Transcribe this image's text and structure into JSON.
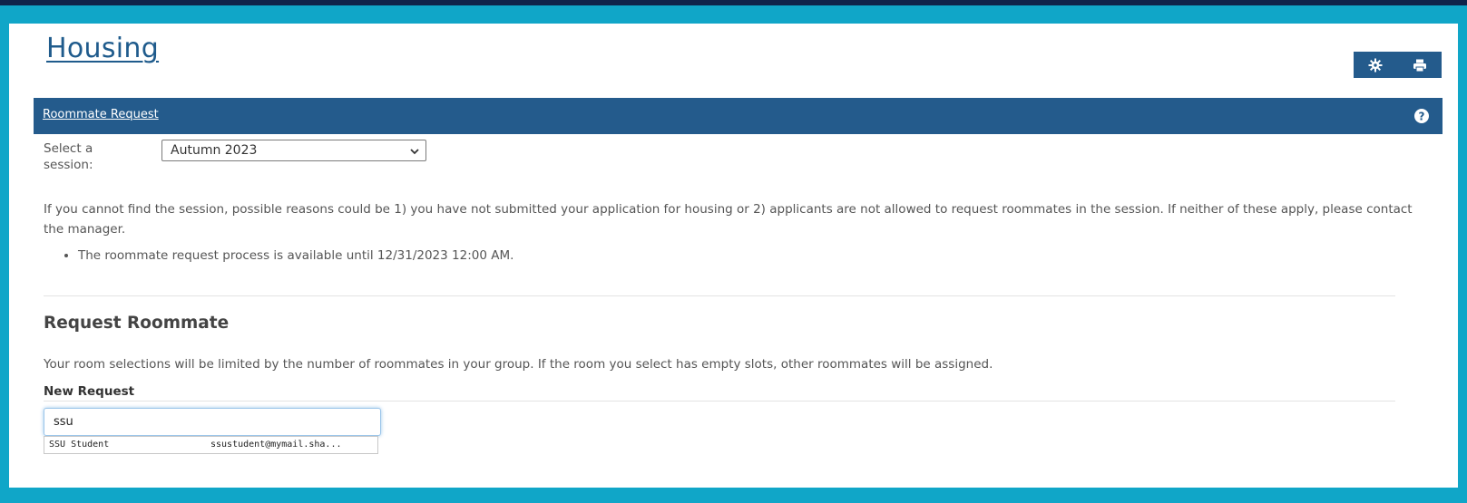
{
  "page": {
    "title": "Housing"
  },
  "toolbar": {
    "settings_icon": "gear-icon",
    "print_icon": "printer-icon"
  },
  "panel": {
    "title": "Roommate Request",
    "help_icon": "question-circle-icon"
  },
  "session": {
    "label": "Select a session:",
    "selected": "Autumn 2023"
  },
  "info": {
    "paragraph": "If you cannot find the session, possible reasons could be 1) you have not submitted your application for housing or 2) applicants are not allowed to request roommates in the session. If neither of these apply, please contact the manager.",
    "bullet": "The roommate request process is available until 12/31/2023 12:00 AM."
  },
  "request": {
    "heading": "Request Roommate",
    "description": "Your room selections will be limited by the number of roommates in your group. If the room you select has empty slots, other roommates will be assigned.",
    "new_label": "New Request",
    "search_value": "ssu",
    "suggestion": {
      "name": "SSU Student",
      "email": "ssustudent@mymail.sha..."
    }
  },
  "colors": {
    "brand": "#245b8c",
    "frame": "#10a6c8",
    "background": "#10244a"
  }
}
